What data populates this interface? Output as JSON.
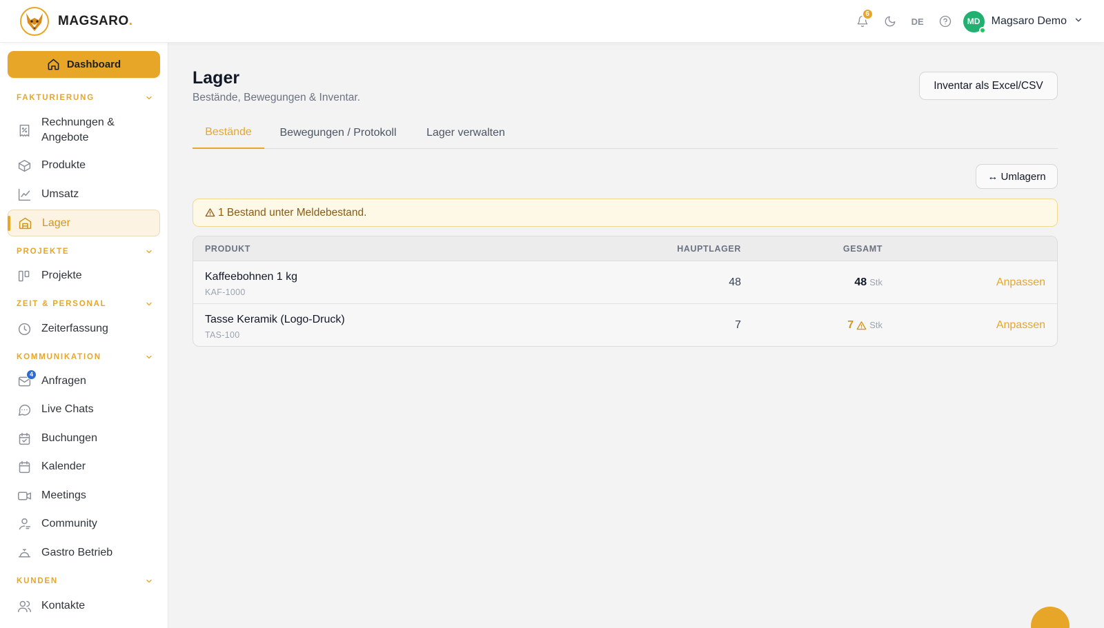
{
  "brand": {
    "name": "MAGSARO",
    "dot": ".",
    "accent": "#e8a628"
  },
  "topbar": {
    "notifications_count": "6",
    "language": "DE",
    "user": {
      "initials": "MD",
      "name": "Magsaro Demo"
    }
  },
  "sidebar": {
    "dashboard_label": "Dashboard",
    "sections": [
      {
        "title": "FAKTURIERUNG",
        "items": [
          {
            "label": "Rechnungen &",
            "label2": "Angebote",
            "icon": "invoice-icon"
          },
          {
            "label": "Produkte",
            "icon": "box-icon"
          },
          {
            "label": "Umsatz",
            "icon": "chart-line-icon"
          },
          {
            "label": "Lager",
            "icon": "warehouse-icon",
            "active": true
          }
        ]
      },
      {
        "title": "PROJEKTE",
        "items": [
          {
            "label": "Projekte",
            "icon": "kanban-icon"
          }
        ]
      },
      {
        "title": "ZEIT & PERSONAL",
        "items": [
          {
            "label": "Zeiterfassung",
            "icon": "clock-icon"
          }
        ]
      },
      {
        "title": "KOMMUNIKATION",
        "items": [
          {
            "label": "Anfragen",
            "icon": "mail-icon",
            "badge": "4"
          },
          {
            "label": "Live Chats",
            "icon": "chat-icon"
          },
          {
            "label": "Buchungen",
            "icon": "booking-icon"
          },
          {
            "label": "Kalender",
            "icon": "calendar-icon"
          },
          {
            "label": "Meetings",
            "icon": "video-icon"
          },
          {
            "label": "Community",
            "icon": "community-icon"
          },
          {
            "label": "Gastro Betrieb",
            "icon": "cloche-icon"
          }
        ]
      },
      {
        "title": "KUNDEN",
        "items": [
          {
            "label": "Kontakte",
            "icon": "users-icon"
          }
        ]
      }
    ]
  },
  "page": {
    "title": "Lager",
    "subtitle": "Bestände, Bewegungen & Inventar.",
    "export_label": "Inventar als Excel/CSV",
    "tabs": [
      {
        "label": "Bestände",
        "active": true
      },
      {
        "label": "Bewegungen / Protokoll"
      },
      {
        "label": "Lager verwalten"
      }
    ],
    "move_label": "↔ Umlagern",
    "alert": "1 Bestand unter Meldebestand."
  },
  "table": {
    "headers": {
      "product": "PRODUKT",
      "main_storage": "HAUPTLAGER",
      "total": "GESAMT"
    },
    "rows": [
      {
        "name": "Kaffeebohnen 1 kg",
        "sku": "KAF-1000",
        "main_storage": "48",
        "total": "48",
        "unit": "Stk",
        "low_stock": false,
        "action": "Anpassen"
      },
      {
        "name": "Tasse Keramik (Logo-Druck)",
        "sku": "TAS-100",
        "main_storage": "7",
        "total": "7",
        "unit": "Stk",
        "low_stock": true,
        "action": "Anpassen"
      }
    ]
  }
}
